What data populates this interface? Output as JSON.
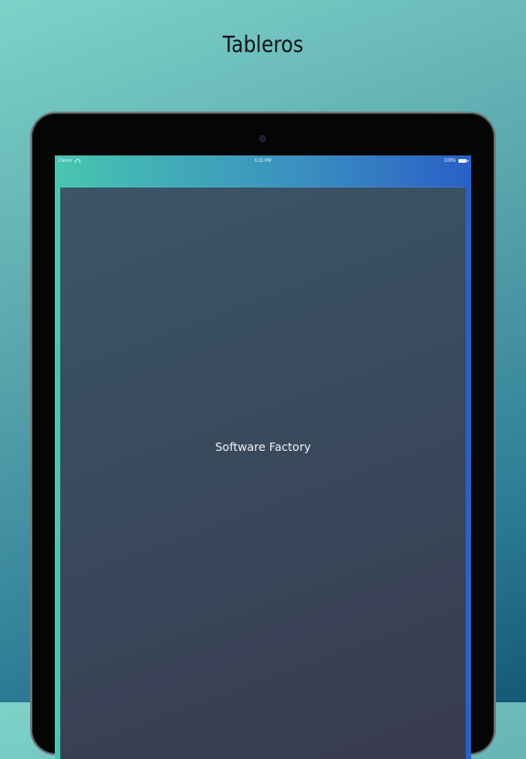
{
  "promo": {
    "title": "Tableros"
  },
  "status_bar": {
    "carrier": "Carrier",
    "time": "6:11 PM",
    "battery": "100%"
  },
  "app": {
    "center_label": "Software Factory"
  },
  "colors": {
    "background_top": "#7dd3c8",
    "background_bottom": "#145977",
    "header_gradient_start": "#47c6b0",
    "header_gradient_end": "#2a5fc7",
    "panel_top": "#3b5569",
    "panel_bottom": "#393a4f"
  },
  "icons": [
    "wifi-icon",
    "battery-icon",
    "camera-icon"
  ]
}
